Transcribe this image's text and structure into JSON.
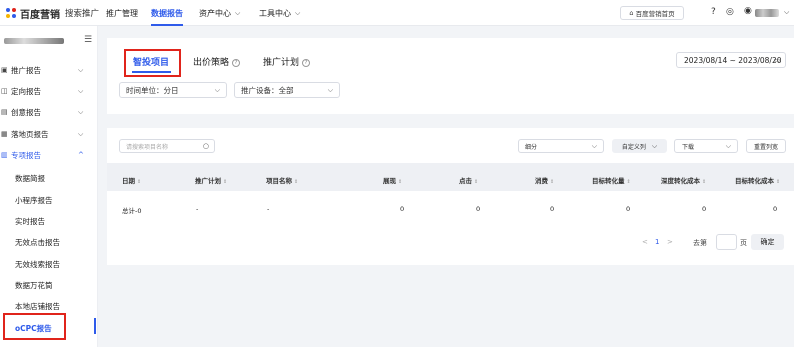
{
  "brand": {
    "logo_text": "百度营销",
    "product": "搜索推广"
  },
  "topnav": {
    "items": [
      "推广管理",
      "数据报告",
      "资产中心",
      "工具中心"
    ],
    "home_button": "百度营销首页"
  },
  "sidebar": {
    "items": [
      "推广报告",
      "定向报告",
      "创意报告",
      "落地页报告",
      "专项报告"
    ],
    "subitems": [
      "数据简报",
      "小程序报告",
      "实时报告",
      "无效点击报告",
      "无效线索报告",
      "数据万花筒",
      "本地店铺报告",
      "oCPC报告"
    ]
  },
  "tabs": [
    "智投项目",
    "出价策略",
    "推广计划"
  ],
  "date_range": "2023/08/14 ~ 2023/08/20",
  "filters": {
    "time_unit": "时间单位：分日",
    "device": "推广设备：全部"
  },
  "toolbar": {
    "search_placeholder": "请搜索项目名称",
    "breakdown": "细分",
    "custom_columns": "自定义列",
    "download": "下载",
    "reset_columns": "重置列宽"
  },
  "table": {
    "columns": [
      "日期",
      "推广计划",
      "项目名称",
      "展现",
      "点击",
      "消费",
      "目标转化量",
      "深度转化成本",
      "目标转化成本"
    ],
    "total_row": [
      "总计-0",
      "-",
      "-",
      "0",
      "0",
      "0",
      "0",
      "0",
      "0"
    ]
  },
  "pagination": {
    "prev": "<",
    "page": "1",
    "next": ">",
    "goto_label": "去第",
    "page_suffix": "页",
    "confirm": "确定"
  }
}
